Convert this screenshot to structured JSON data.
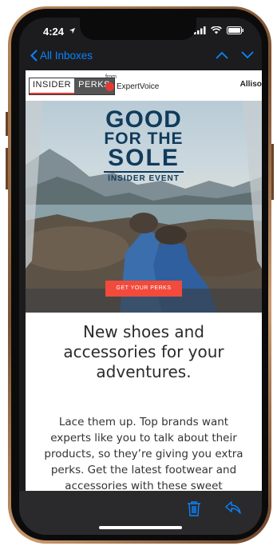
{
  "status": {
    "time": "4:24"
  },
  "nav": {
    "back_label": "All Inboxes"
  },
  "brand": {
    "logo_left": "INSIDER",
    "logo_right": "PERKS",
    "from_label": "from",
    "partner": "ExpertVoice",
    "user_name": "Allison"
  },
  "hero": {
    "line1": "GOOD",
    "line2": "FOR THE",
    "line3": "SOLE",
    "line4": "INSIDER EVENT",
    "cta_label": "GET YOUR PERKS"
  },
  "content": {
    "subheading": "New shoes and accessories for your adventures.",
    "body": "Lace them up. Top brands want experts like you to talk about their products, so they’re giving you extra perks. Get the latest footwear and accessories with these sweet"
  },
  "colors": {
    "accent": "#0a84ff",
    "brand_navy": "#103b5c",
    "cta": "#f24a3b"
  },
  "icons": [
    "location-arrow-icon",
    "signal-icon",
    "wifi-icon",
    "battery-icon",
    "chevron-left-icon",
    "chevron-up-icon",
    "chevron-down-icon",
    "trash-icon",
    "reply-icon"
  ]
}
